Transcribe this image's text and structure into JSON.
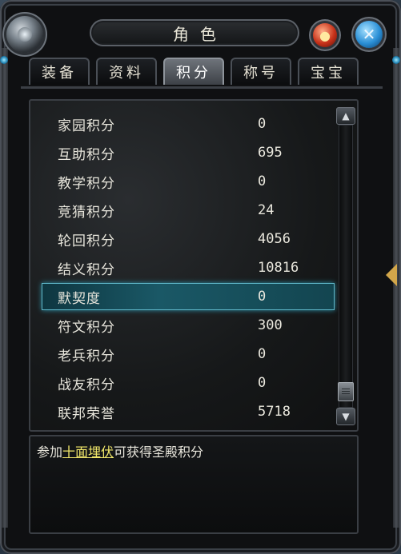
{
  "window": {
    "title": "角色"
  },
  "tabs": [
    {
      "label": "装备"
    },
    {
      "label": "资料"
    },
    {
      "label": "积分"
    },
    {
      "label": "称号"
    },
    {
      "label": "宝宝"
    }
  ],
  "active_tab": "积分",
  "scores": [
    {
      "label": "家园积分",
      "value": "0"
    },
    {
      "label": "互助积分",
      "value": "695"
    },
    {
      "label": "教学积分",
      "value": "0"
    },
    {
      "label": "竞猜积分",
      "value": "24"
    },
    {
      "label": "轮回积分",
      "value": "4056"
    },
    {
      "label": "结义积分",
      "value": "10816"
    },
    {
      "label": "默契度",
      "value": "0"
    },
    {
      "label": "符文积分",
      "value": "300"
    },
    {
      "label": "老兵积分",
      "value": "0"
    },
    {
      "label": "战友积分",
      "value": "0"
    },
    {
      "label": "联邦荣誉",
      "value": "5718"
    }
  ],
  "selected_row": "默契度",
  "description": {
    "prefix": "参加",
    "link": "十面埋伏",
    "suffix": "可获得圣殿积分"
  },
  "icons": {
    "help": "help-orb-icon",
    "close": "close-x-icon"
  },
  "colors": {
    "highlight_text": "#f0e66a",
    "selected_row": "#1a5866"
  }
}
